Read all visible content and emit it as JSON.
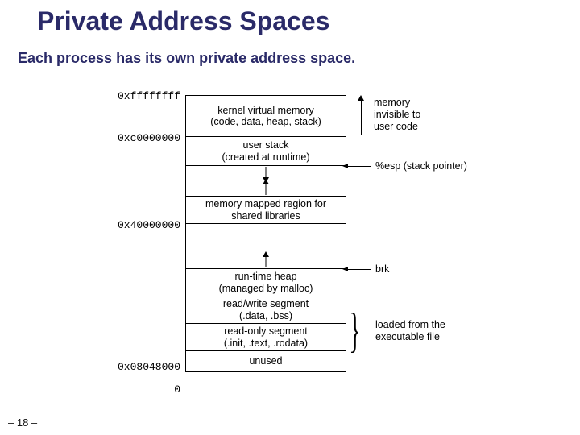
{
  "title": "Private Address Spaces",
  "subtitle": "Each process has its own private address space.",
  "addresses": {
    "top": "0xffffffff",
    "kern": "0xc0000000",
    "mmap": "0x40000000",
    "text": "0x08048000",
    "zero": "0"
  },
  "regions": {
    "kernel": "kernel virtual memory\n(code, data, heap, stack)",
    "ustack": "user stack\n(created at runtime)",
    "mmap": "memory mapped region for\nshared libraries",
    "heap": "run-time heap\n(managed by malloc)",
    "rw": "read/write segment\n(.data, .bss)",
    "ro": "read-only segment\n(.init, .text, .rodata)",
    "unused": "unused"
  },
  "notes": {
    "invisible": "memory\ninvisible to\nuser code",
    "esp": "%esp (stack pointer)",
    "brk": "brk",
    "loaded": "loaded from the\nexecutable file"
  },
  "slide": "– 18 –"
}
